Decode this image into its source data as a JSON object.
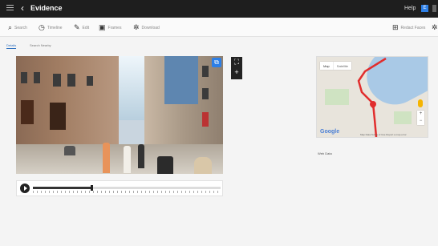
{
  "topbar": {
    "title": "Evidence",
    "help": "Help",
    "user_initial": "E"
  },
  "toolbar": {
    "items": [
      {
        "icon": "search-icon",
        "glyph": "⌕",
        "label": "Search"
      },
      {
        "icon": "clock-icon",
        "glyph": "◷",
        "label": "Timeline"
      },
      {
        "icon": "pencil-icon",
        "glyph": "✎",
        "label": "Edit"
      },
      {
        "icon": "camera-icon",
        "glyph": "▣",
        "label": "Frames"
      },
      {
        "icon": "gear-icon",
        "glyph": "✲",
        "label": "Download"
      }
    ],
    "redact": {
      "icon": "redact-icon",
      "glyph": "⊞",
      "label": "Redact Faces"
    }
  },
  "tabs": [
    {
      "label": "Details",
      "active": true
    },
    {
      "label": "Search Nearby",
      "active": false
    }
  ],
  "video": {
    "progress": 0.31
  },
  "player": {
    "tick_labels": [
      "",
      "",
      "",
      "",
      "",
      "",
      ""
    ]
  },
  "map": {
    "types": [
      "Map",
      "Satellite"
    ],
    "logo": "Google",
    "footer": "Map Data   Terms of Use   Report a map error"
  },
  "web_data_label": "Web Data",
  "colors": {
    "accent": "#2d7fe6",
    "route": "#e12d2d",
    "topbar": "#1e1e1e"
  }
}
